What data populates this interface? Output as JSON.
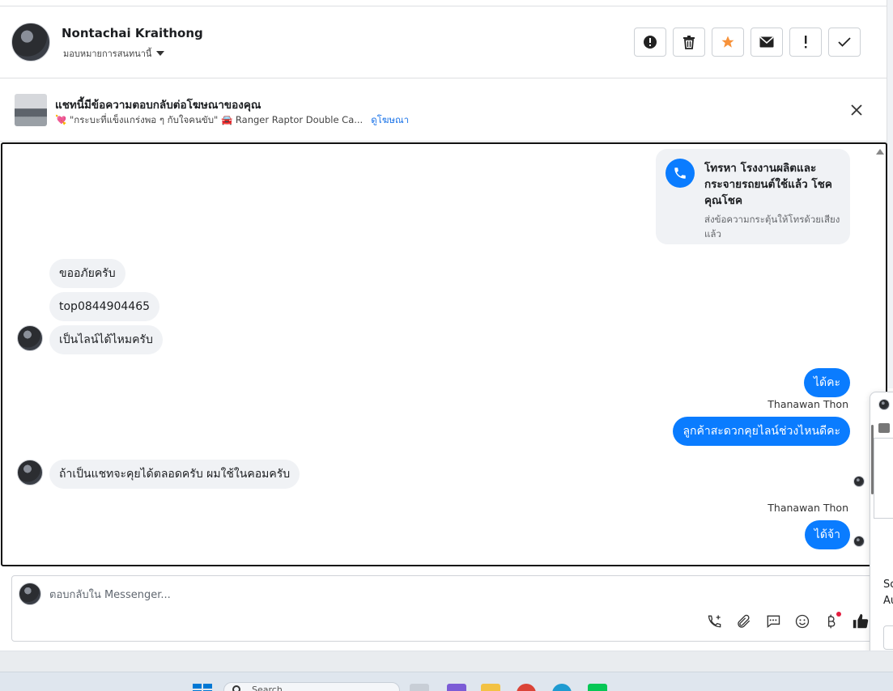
{
  "header": {
    "name": "Nontachai Kraithong",
    "assign_label": "มอบหมายการสนทนานี้",
    "actions": [
      {
        "icon": "alert-circle-icon",
        "name": "spam-button"
      },
      {
        "icon": "trash-icon",
        "name": "delete-button"
      },
      {
        "icon": "star-icon",
        "name": "star-button"
      },
      {
        "icon": "mail-icon",
        "name": "mark-unread-button"
      },
      {
        "icon": "exclamation-icon",
        "name": "follow-up-button"
      },
      {
        "icon": "check-icon",
        "name": "mark-done-button"
      }
    ]
  },
  "ad_banner": {
    "title": "แชทนี้มีข้อความตอบกลับต่อโฆษณาของคุณ",
    "subtitle": "💘 \"กระบะที่แข็งแกร่งพอ ๆ กับใจคนขับ\" 🚘 Ranger Raptor Double Ca...",
    "link": "ดูโฆษณา"
  },
  "call_card": {
    "title": "โทรหา โรงงานผลิตและกระจายรถยนต์ใช้แล้ว โชคคุณโชค",
    "subtitle": "ส่งข้อความกระตุ้นให้โทรด้วยเสียงแล้ว"
  },
  "messages": [
    {
      "text": "ขออภัยครับ",
      "dir": "in"
    },
    {
      "text": "top0844904465",
      "dir": "in"
    },
    {
      "text": "เป็นไลน์ได้ไหมครับ",
      "dir": "in"
    },
    {
      "text": "ได้คะ",
      "dir": "out"
    },
    {
      "sender": "Thanawan Thon"
    },
    {
      "text": "ลูกค้าสะดวกคุยไลน์ช่วงไหนดีคะ",
      "dir": "out"
    },
    {
      "text": "ถ้าเป็นแชทจะคุยได้ตลอดครับ ผมใช้ในคอมครับ",
      "dir": "in"
    },
    {
      "sender": "Thanawan Thon"
    },
    {
      "text": "ได้จ้า",
      "dir": "out"
    }
  ],
  "composer": {
    "placeholder": "ตอบกลับใน Messenger..."
  },
  "float_window": {
    "line1": "Sc",
    "line2": "Au"
  },
  "taskbar": {
    "search_placeholder": "Search"
  },
  "colors": {
    "accent": "#0a7cff",
    "star": "#f7923a"
  }
}
